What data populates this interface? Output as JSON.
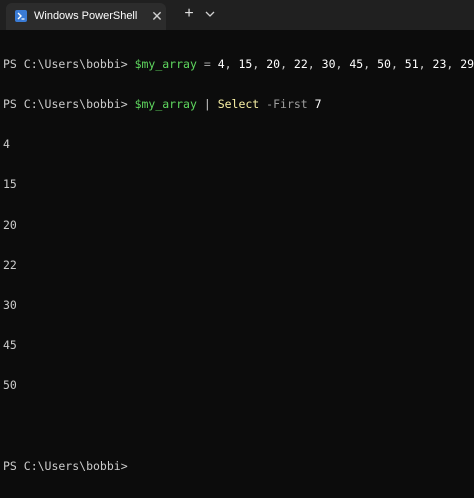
{
  "window": {
    "tab_title": "Windows PowerShell",
    "close_glyph": "✕",
    "new_tab_glyph": "+",
    "icon": "powershell-icon"
  },
  "colors": {
    "background": "#0c0c0c",
    "text": "#cccccc",
    "variable": "#5fd75f",
    "cmdlet": "#f9f1a5",
    "operator": "#9e9e9e"
  },
  "terminal": {
    "prompt": "PS C:\\Users\\bobbi> ",
    "command1": {
      "variable": "$my_array",
      "operator": "=",
      "values": [
        "4",
        "15",
        "20",
        "22",
        "30",
        "45",
        "50",
        "51",
        "23",
        "29"
      ]
    },
    "command2": {
      "variable": "$my_array",
      "pipe": "|",
      "cmdlet": "Select",
      "parameter": "-First",
      "argument": "7"
    },
    "output": [
      "4",
      "15",
      "20",
      "22",
      "30",
      "45",
      "50"
    ],
    "final_prompt": "PS C:\\Users\\bobbi> "
  }
}
